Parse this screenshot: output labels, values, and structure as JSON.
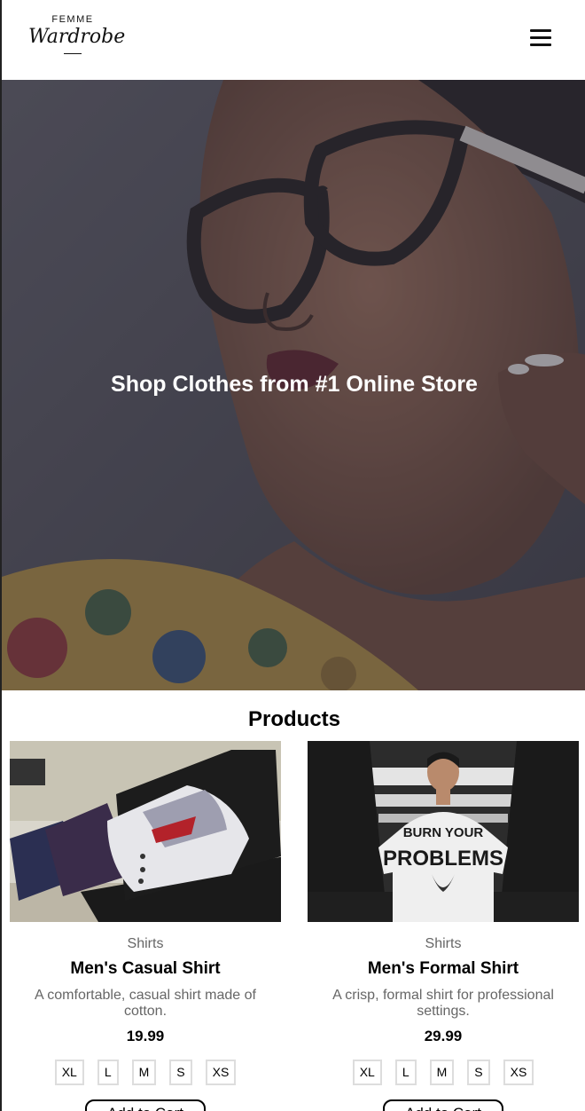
{
  "header": {
    "logo_top": "FEMME",
    "logo_main": "Wardrobe",
    "menu_icon": "hamburger-icon"
  },
  "hero": {
    "title": "Shop Clothes from #1 Online Store"
  },
  "products": {
    "title": "Products",
    "items": [
      {
        "category": "Shirts",
        "name": "Men's Casual Shirt",
        "description": "A comfortable, casual shirt made of cotton.",
        "price": "19.99",
        "sizes": [
          "XL",
          "L",
          "M",
          "S",
          "XS"
        ],
        "button": "Add to Cart"
      },
      {
        "category": "Shirts",
        "name": "Men's Formal Shirt",
        "description": "A crisp, formal shirt for professional settings.",
        "price": "29.99",
        "sizes": [
          "XL",
          "L",
          "M",
          "S",
          "XS"
        ],
        "button": "Add to Cart"
      }
    ],
    "tshirt_print_line1": "BURN YOUR",
    "tshirt_print_line2": "PROBLEMS"
  }
}
